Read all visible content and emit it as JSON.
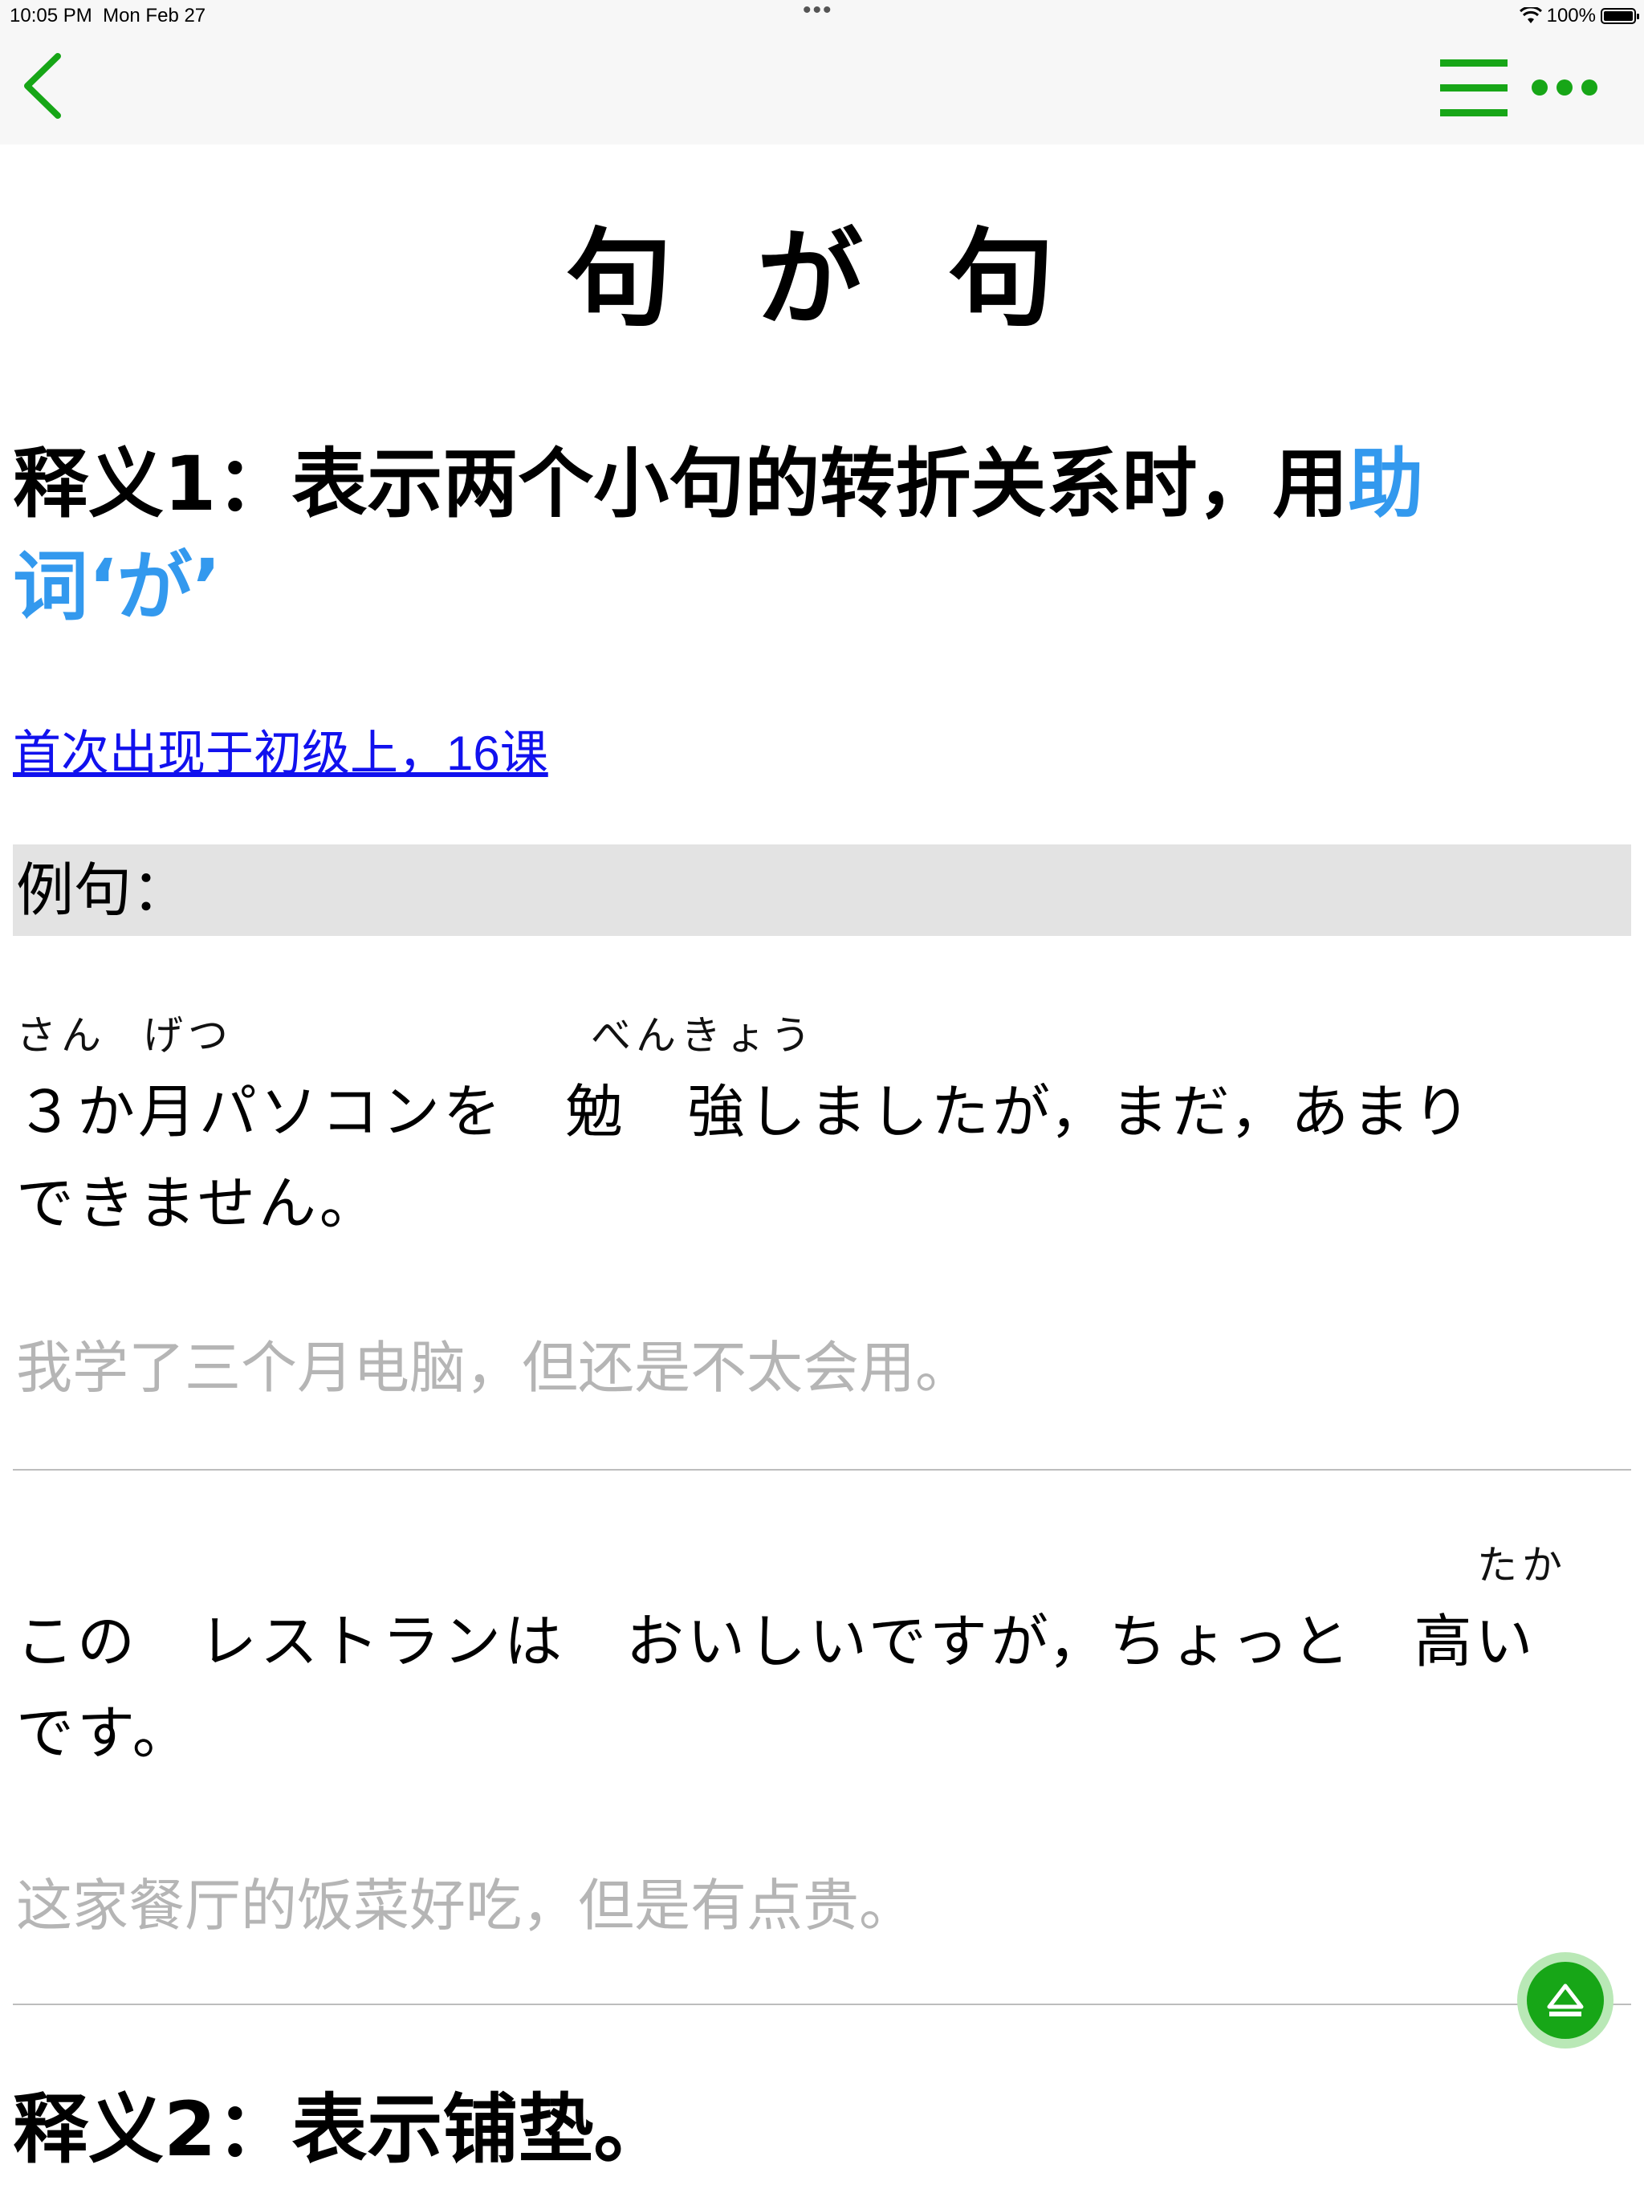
{
  "status": {
    "time": "10:05 PM",
    "date": "Mon Feb 27",
    "battery": "100%"
  },
  "colors": {
    "accent": "#17a617",
    "link": "#1111ee",
    "highlight": "#3399ee",
    "translation": "#b5b5b5"
  },
  "nav": {
    "back_icon": "chevron-left-icon",
    "menu_icon": "hamburger-menu-icon",
    "more_icon": "ellipsis-icon"
  },
  "title": "句 が 句",
  "meaning1": {
    "prefix": "释义1：表示两个小句的转折关系时，用",
    "link": "助词‘が’"
  },
  "first_appearance": "首次出现于初级上，16课",
  "examples_header": "例句：",
  "examples": [
    {
      "furigana": [
        "さん",
        "げつ",
        "べんきょう"
      ],
      "line1": "３か月パソコンを　勉　強しましたが，まだ，あまり",
      "line2": "できません。",
      "translation": "我学了三个月电脑，但还是不太会用。"
    },
    {
      "furigana": [
        "たか"
      ],
      "line1": "この　レストランは　おいしいですが，ちょっと　高い",
      "line2": "です。",
      "translation": "这家餐厅的饭菜好吃，但是有点贵。"
    }
  ],
  "meaning2": "释义2：表示铺垫。",
  "scroll_top_icon": "eject-up-icon"
}
